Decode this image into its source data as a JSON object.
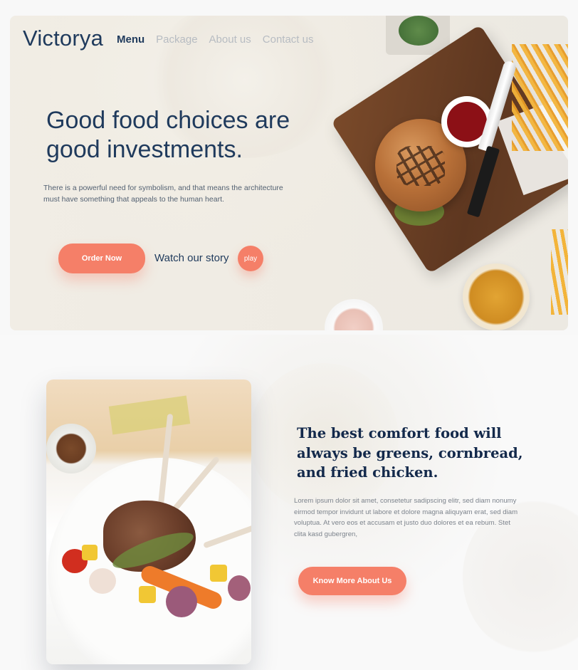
{
  "brand": {
    "logo": "Victorya"
  },
  "nav": {
    "items": [
      {
        "label": "Menu",
        "active": true
      },
      {
        "label": "Package",
        "active": false
      },
      {
        "label": "About us",
        "active": false
      },
      {
        "label": "Contact us",
        "active": false
      }
    ]
  },
  "hero": {
    "title": "Good food choices are good investments.",
    "description": "There is a powerful need for symbolism, and that means the architecture must have something that appeals to the human heart.",
    "order_button": "Order Now",
    "watch_label": "Watch our story",
    "play_label": "play"
  },
  "section2": {
    "title": "The best comfort food will always be greens, cornbread, and fried chicken.",
    "body": "Lorem ipsum dolor sit amet, consetetur sadipscing elitr, sed diam nonumy eirmod tempor invidunt ut labore et dolore magna aliquyam erat, sed diam voluptua. At vero eos et accusam et justo duo dolores et ea rebum. Stet clita kasd gubergren,",
    "button": "Know More About Us"
  },
  "colors": {
    "accent": "#f57f68",
    "primary_text": "#1f3a5c",
    "muted_nav": "#b7bcc2"
  }
}
